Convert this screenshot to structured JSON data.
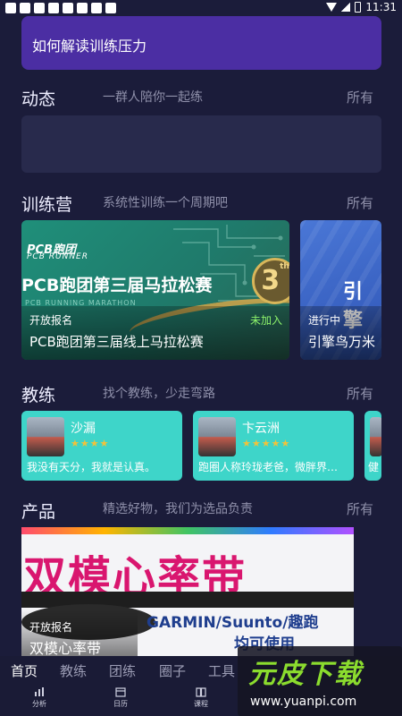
{
  "status_bar": {
    "time": "11:31"
  },
  "banner": {
    "text": "如何解读训练压力"
  },
  "feed": {
    "title": "动态",
    "subtitle": "一群人陪你一起练",
    "all": "所有"
  },
  "camps": {
    "title": "训练营",
    "subtitle": "系统性训练一个周期吧",
    "all": "所有",
    "items": [
      {
        "brand": "PCB跑团",
        "brand_en": "PCB RUNNER",
        "headline": "PCB跑团第三届马拉松赛",
        "faint": "PCB RUNNING  MARATHON",
        "badge": "3",
        "badge_sup": "th",
        "status": "开放报名",
        "name": "PCB跑团第三届线上马拉松赛",
        "join": "未加入"
      },
      {
        "headline": "引擎",
        "status": "进行中",
        "name": "引擎鸟万米"
      }
    ]
  },
  "coaches": {
    "title": "教练",
    "subtitle": "找个教练，少走弯路",
    "all": "所有",
    "items": [
      {
        "name": "沙漏",
        "stars": "★★★★",
        "desc": "我没有天分，我就是认真。"
      },
      {
        "name": "卞云洲",
        "stars": "★★★★★",
        "desc": "跑圈人称玲珑老爸，微胖界…"
      },
      {
        "desc": "健"
      }
    ]
  },
  "products": {
    "title": "产品",
    "subtitle": "精选好物，我们为选品负责",
    "all": "所有",
    "items": [
      {
        "big": "双模心率带",
        "brands": "GARMIN/Suunto/趣跑",
        "use": "均可使用",
        "status": "开放报名",
        "name": "双模心率带"
      }
    ]
  },
  "tabs": [
    "首页",
    "教练",
    "团练",
    "圈子",
    "工具"
  ],
  "nav": [
    {
      "icon": "bar-chart-icon",
      "label": "分析"
    },
    {
      "icon": "calendar-icon",
      "label": "日历"
    },
    {
      "icon": "book-icon",
      "label": "课程"
    }
  ],
  "watermark": {
    "logo": "元皮下载",
    "url": "www.yuanpi.com"
  }
}
